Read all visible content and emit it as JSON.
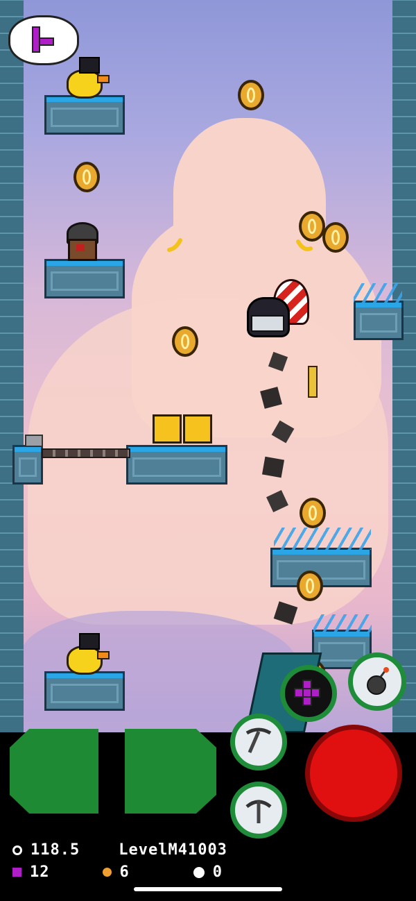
{
  "hud": {
    "timer_value": "118.5",
    "level_name": "LevelM41003",
    "blocks_count": "12",
    "bombs_count": "6",
    "coins_count": "0"
  },
  "colors": {
    "coin": "#e9a92e",
    "block_piece": "#b01ec8",
    "fire_button": "#e01010",
    "move_button": "#1e8a34",
    "ice_top": "#2aa6e6"
  },
  "controls": {
    "left": "arrow-left-icon",
    "right": "arrow-right-icon",
    "place_block": "tetromino-icon",
    "bomb": "bomb-icon",
    "pickaxe": "pickaxe-icon",
    "jump": "arrow-up-icon",
    "fire": "red-action-icon"
  }
}
